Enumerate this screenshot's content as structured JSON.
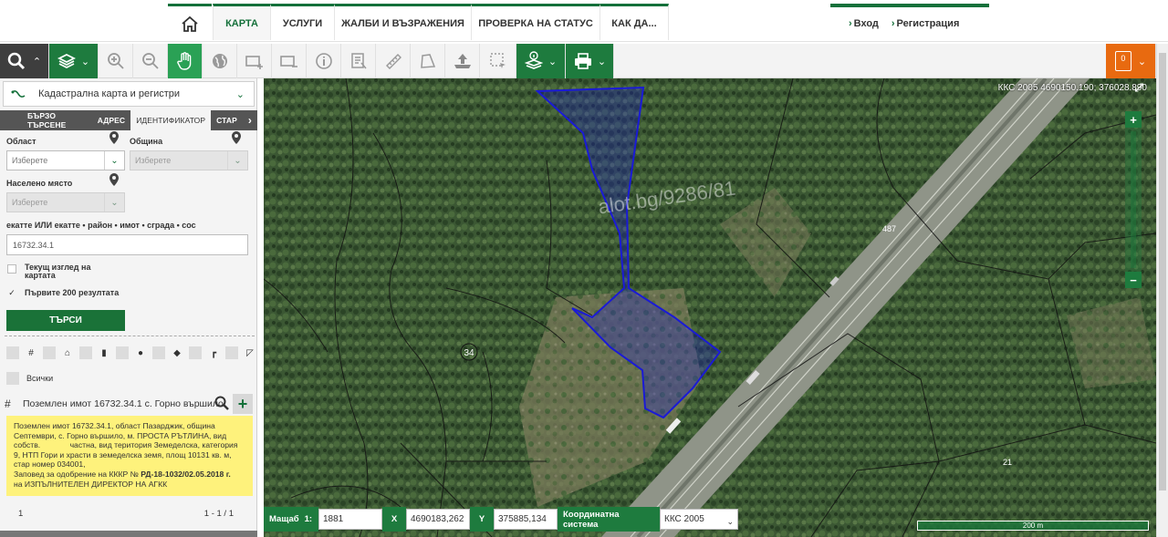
{
  "nav": {
    "tabs": [
      {
        "label": "КАРТА"
      },
      {
        "label": "УСЛУГИ"
      },
      {
        "label": "ЖАЛБИ И ВЪЗРАЖЕНИЯ"
      },
      {
        "label": "ПРОВЕРКА НА СТАТУС"
      },
      {
        "label": "КАК ДА..."
      }
    ],
    "login": "Вход",
    "register": "Регистрация"
  },
  "toolbar": {
    "notifications_count": "0"
  },
  "sidebar": {
    "layer": "Кадастрална карта и регистри",
    "subtabs": [
      "БЪРЗО ТЪРСЕНЕ",
      "АДРЕС",
      "ИДЕНТИФИКАТОР",
      "СТАР"
    ],
    "active_subtab": "ИДЕНТИФИКАТОР",
    "region_label": "Област",
    "municipality_label": "Община",
    "settlement_label": "Населено място",
    "select_placeholder": "Изберете",
    "identifier_label": "екатте ИЛИ екатте • район • имот • сграда • сос",
    "identifier_value": "16732.34.1",
    "current_view_label": "Текущ изглед на картата",
    "first200_label": "Първите 200 резултата",
    "first200_checked": "✓",
    "search_button": "ТЪРСИ",
    "all_label": "Всички",
    "result_title": "Поземлен имот 16732.34.1 с. Горно вършило",
    "result_text_1": "Поземлен имот 16732.34.1, област Пазарджик, община Септември, с. Горно вършило, м. ПРОСТА РЪТЛИНА, вид собств.",
    "result_text_2": "частна, вид територия Земеделска, категория 9, НТП Гори и храсти в земеделска земя, площ 10131 кв. м, стар номер 034001,",
    "result_text_3": "Заповед за одобрение на КККР №",
    "result_order": "РД-18-1032/02.05.2018 г.",
    "result_text_4": "на ИЗПЪЛНИТЕЛЕН ДИРЕКТОР НА АГКК",
    "pager_page": "1",
    "pager_count": "1 - 1 / 1"
  },
  "map": {
    "coords_top": "ККС 2005 4690150.190; 376028.890",
    "watermark": "alot.bg/9286/81",
    "labels": {
      "road_parcel": "487",
      "parcel_34": "34",
      "parcel_21": "21"
    },
    "scale_label": "Мащаб",
    "scale_prefix": "1:",
    "scale_value": "1881",
    "x_label": "X",
    "x_value": "4690183,262",
    "y_label": "Y",
    "y_value": "375885,134",
    "crs_label": "Координатна система",
    "crs_value": "ККС 2005",
    "scalebar": "200 m",
    "parcel_color": "#1a1ad6"
  }
}
